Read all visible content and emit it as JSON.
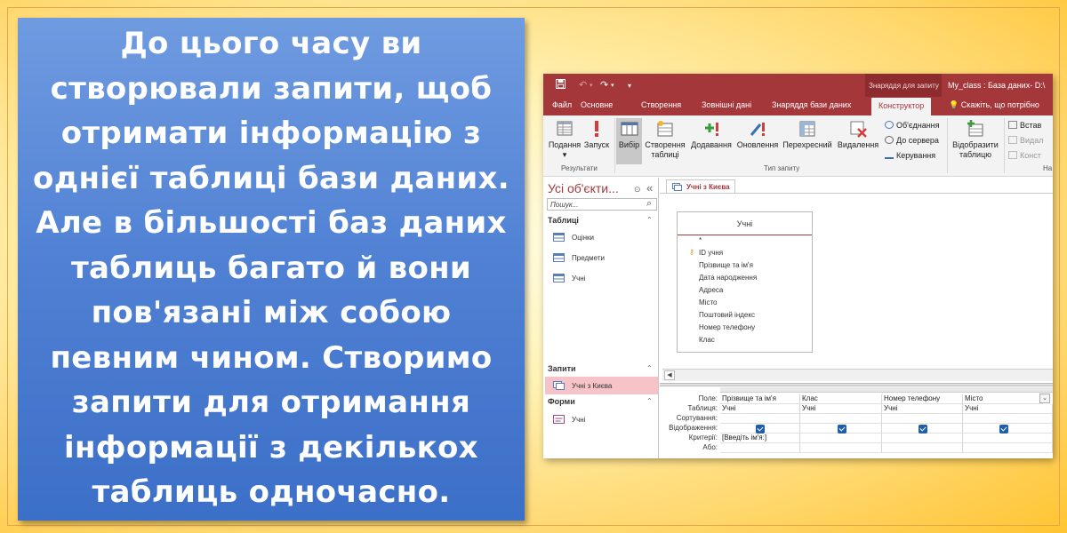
{
  "slide": {
    "text": "До цього часу ви\nстворювали запити, щоб\nотримати інформацію з\nоднієї таблиці бази даних.\nАле в більшості баз даних\nтаблиць багато й вони\nпов'язані між собою\nпевним чином. Створимо\nзапити для отримання\nінформації з декількох\nтаблиць одночасно."
  },
  "window": {
    "context_tab_group": "Знаряддя для запиту",
    "app_title": "My_class : База даних- D:\\",
    "tell_me": "Скажіть, що потрібно",
    "tabs": [
      "Файл",
      "Основне",
      "Створення",
      "Зовнішні дані",
      "Знаряддя бази даних"
    ],
    "active_tab": "Конструктор"
  },
  "ribbon": {
    "buttons": {
      "view": "Подання",
      "run": "Запуск",
      "select": "Вибір",
      "make_table_1": "Створення",
      "make_table_2": "таблиці",
      "append": "Додавання",
      "update": "Оновлення",
      "crosstab": "Перехресний",
      "delete": "Видалення",
      "union": "Об'єднання",
      "pass_through": "До сервера",
      "data_definition": "Керування",
      "show_table_1": "Відобразити",
      "show_table_2": "таблицю",
      "insert_rows": "Встав",
      "delete_rows": "Видал",
      "builder": "Конст"
    },
    "groups": {
      "results": "Результати",
      "query_type": "Тип запиту",
      "setup": "На"
    }
  },
  "nav": {
    "title": "Усі об'єкти...",
    "search_placeholder": "Пошук...",
    "sections": [
      {
        "label": "Таблиці",
        "items": [
          "Оцінки",
          "Предмети",
          "Учні"
        ]
      },
      {
        "label": "Запити",
        "items": [
          "Учні з Києва"
        ]
      },
      {
        "label": "Форми",
        "items": [
          "Учні"
        ]
      }
    ]
  },
  "document": {
    "tab_label": "Учні з Києва",
    "table": {
      "name": "Учні",
      "fields": [
        "*",
        "ID учня",
        "Прізвище та ім'я",
        "Дата народження",
        "Адреса",
        "Місто",
        "Поштовий індекс",
        "Номер телефону",
        "Клас"
      ]
    },
    "grid": {
      "row_labels": [
        "Поле:",
        "Таблиця:",
        "Сортування:",
        "Відображення:",
        "Критерії:",
        "Або:"
      ],
      "columns": [
        {
          "field": "Прізвище та ім'я",
          "table": "Учні",
          "show": true,
          "criteria": "[Введіть ім'я:]"
        },
        {
          "field": "Клас",
          "table": "Учні",
          "show": true,
          "criteria": ""
        },
        {
          "field": "Номер телефону",
          "table": "Учні",
          "show": true,
          "criteria": ""
        },
        {
          "field": "Місто",
          "table": "Учні",
          "show": true,
          "criteria": ""
        }
      ]
    }
  }
}
